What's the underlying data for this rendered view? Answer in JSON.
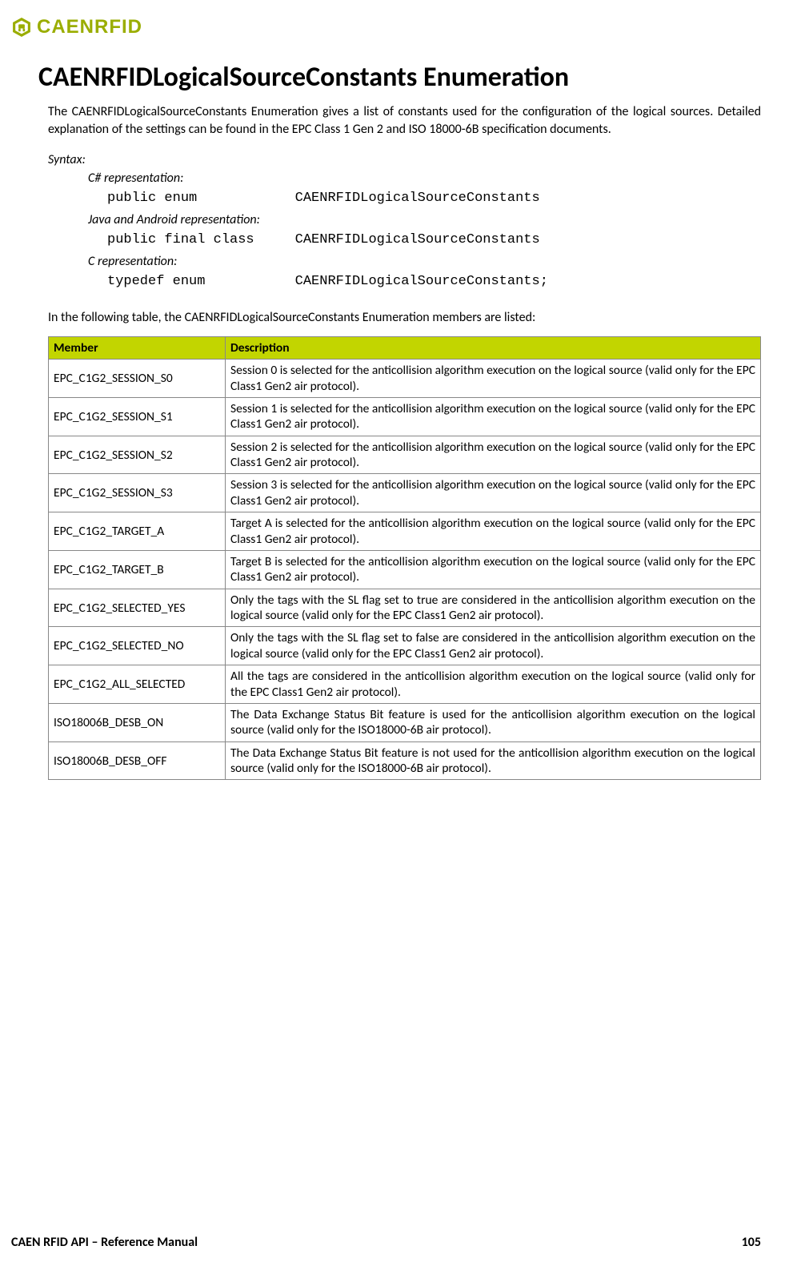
{
  "brand": "CAENRFID",
  "title": "CAENRFIDLogicalSourceConstants Enumeration",
  "intro": "The CAENRFIDLogicalSourceConstants Enumeration gives a list of constants used for the configuration of the logical sources. Detailed explanation of the settings can be found in the EPC Class 1 Gen 2 and ISO 18000-6B specification documents.",
  "syntax_label": "Syntax:",
  "reps": [
    {
      "label": "C# representation:",
      "code": "public enum            CAENRFIDLogicalSourceConstants"
    },
    {
      "label": "Java and Android representation:",
      "code": "public final class     CAENRFIDLogicalSourceConstants"
    },
    {
      "label": "C representation:",
      "code": "typedef enum           CAENRFIDLogicalSourceConstants;"
    }
  ],
  "table_intro": "In the following table, the CAENRFIDLogicalSourceConstants Enumeration members are listed:",
  "columns": {
    "member": "Member",
    "description": "Description"
  },
  "rows": [
    {
      "member": "EPC_C1G2_SESSION_S0",
      "desc": "Session 0 is selected for the anticollision algorithm execution on the logical source (valid only for the EPC Class1 Gen2 air protocol)."
    },
    {
      "member": "EPC_C1G2_SESSION_S1",
      "desc": "Session 1 is selected for the anticollision algorithm execution on the logical source (valid only for the EPC Class1 Gen2 air protocol)."
    },
    {
      "member": "EPC_C1G2_SESSION_S2",
      "desc": "Session 2 is selected for the anticollision algorithm execution on the logical source (valid only for the EPC Class1 Gen2 air protocol)."
    },
    {
      "member": "EPC_C1G2_SESSION_S3",
      "desc": "Session 3 is selected for the anticollision algorithm execution on the logical source (valid only for the EPC Class1 Gen2 air protocol)."
    },
    {
      "member": "EPC_C1G2_TARGET_A",
      "desc": "Target A is selected for the anticollision algorithm execution on the logical source (valid only for the EPC Class1 Gen2 air protocol)."
    },
    {
      "member": "EPC_C1G2_TARGET_B",
      "desc": "Target B is selected for the anticollision algorithm execution on the logical source (valid only for the EPC Class1 Gen2 air protocol)."
    },
    {
      "member": "EPC_C1G2_SELECTED_YES",
      "desc": "Only the tags with the SL flag set to true are considered in the anticollision algorithm execution on the logical source (valid only for the EPC Class1 Gen2 air protocol)."
    },
    {
      "member": "EPC_C1G2_SELECTED_NO",
      "desc": "Only the tags with the SL flag set to false are considered in the anticollision algorithm execution on the logical source (valid only for the EPC Class1 Gen2 air protocol)."
    },
    {
      "member": "EPC_C1G2_ALL_SELECTED",
      "desc": "All the tags are considered in the anticollision algorithm execution on the logical source (valid only for the EPC Class1 Gen2 air protocol)."
    },
    {
      "member": "ISO18006B_DESB_ON",
      "desc": "The Data Exchange Status Bit feature is used for the anticollision algorithm execution on the logical source (valid only for the ISO18000-6B air protocol)."
    },
    {
      "member": "ISO18006B_DESB_OFF",
      "desc": "The Data Exchange Status Bit feature is not used for the anticollision algorithm execution on the logical source (valid only for the ISO18000-6B air protocol)."
    }
  ],
  "footer": {
    "left": "CAEN RFID API – Reference Manual",
    "right": "105"
  }
}
